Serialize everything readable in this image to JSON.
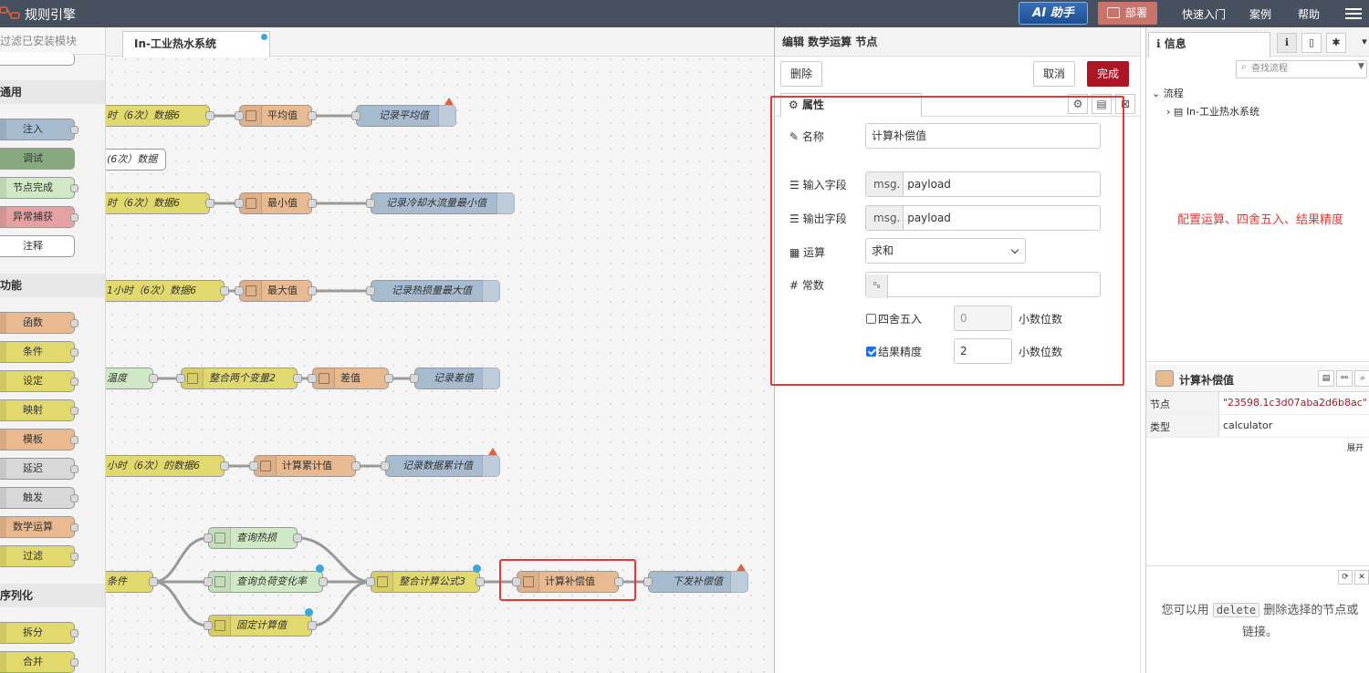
{
  "header": {
    "title": "规则引擎",
    "ai_label": "AI 助手",
    "deploy_label": "部署",
    "links": [
      "快速入门",
      "案例",
      "帮助"
    ]
  },
  "palette": {
    "filter_placeholder": "过滤已安装模块",
    "categories": [
      "通用",
      "功能",
      "序列化"
    ],
    "common_nodes": [
      "注入",
      "调试",
      "节点完成",
      "异常捕获",
      "注释"
    ],
    "function_nodes": [
      "函数",
      "条件",
      "设定",
      "映射",
      "模板",
      "延迟",
      "触发",
      "数学运算",
      "过滤"
    ],
    "sequence_nodes": [
      "拆分",
      "合并"
    ]
  },
  "workspace": {
    "tab_label": "In-工业热水系统",
    "nodes": {
      "r1a": "时（6次）数据6",
      "r1b": "平均值",
      "r1c": "记录平均值",
      "r2a": "(6次）数据",
      "r3a": "时（6次）数据6",
      "r3b": "最小值",
      "r3c": "记录冷却水流量最小值",
      "r4a": "1小时（6次）数据6",
      "r4b": "最大值",
      "r4c": "记录热损量最大值",
      "r5a": "温度",
      "r5b": "整合两个变量2",
      "r5c": "差值",
      "r5d": "记录差值",
      "r6a": "小时（6次）的数据6",
      "r6b": "计算累计值",
      "r6c": "记录数据累计值",
      "r7cond": "条件",
      "r7q1": "查询热损",
      "r7q2": "查询负荷变化率",
      "r7q3": "固定计算值",
      "r7merge": "整合计算公式3",
      "r7calc": "计算补偿值",
      "r7out": "下发补偿值"
    }
  },
  "editor": {
    "title": "编辑 数学运算 节点",
    "delete_label": "删除",
    "cancel_label": "取消",
    "done_label": "完成",
    "tab_properties": "属性",
    "name_label": "名称",
    "name_value": "计算补偿值",
    "input_label": "输入字段",
    "input_prefix": "msg.",
    "input_value": "payload",
    "output_label": "输出字段",
    "output_prefix": "msg.",
    "output_value": "payload",
    "op_label": "运算",
    "op_value": "求和",
    "const_label": "常数",
    "const_type": "⁰₉",
    "round_label": "四舍五入",
    "round_value": "0",
    "round_checked": false,
    "precision_label": "结果精度",
    "precision_value": "2",
    "precision_checked": true,
    "decimal_label": "小数位数"
  },
  "sidebar": {
    "tab_info": "信息",
    "search_placeholder": "查找流程",
    "tree_root": "流程",
    "tree_item": "In-工业热水系统",
    "annotation": "配置运算、四舍五入、结果精度",
    "node_title": "计算补偿值",
    "props": [
      {
        "key": "节点",
        "value": "\"23598.1c3d07aba2d6b8ac\""
      },
      {
        "key": "类型",
        "value": "calculator"
      }
    ],
    "expand_label": "展开",
    "help_before": "您可以用",
    "help_code": "delete",
    "help_after": "删除选择的节点或链接。"
  },
  "colors": {
    "header_bg": "#47505f",
    "deploy_bg": "#c9736a",
    "done_bg": "#ad1625",
    "highlight": "#e53935"
  }
}
